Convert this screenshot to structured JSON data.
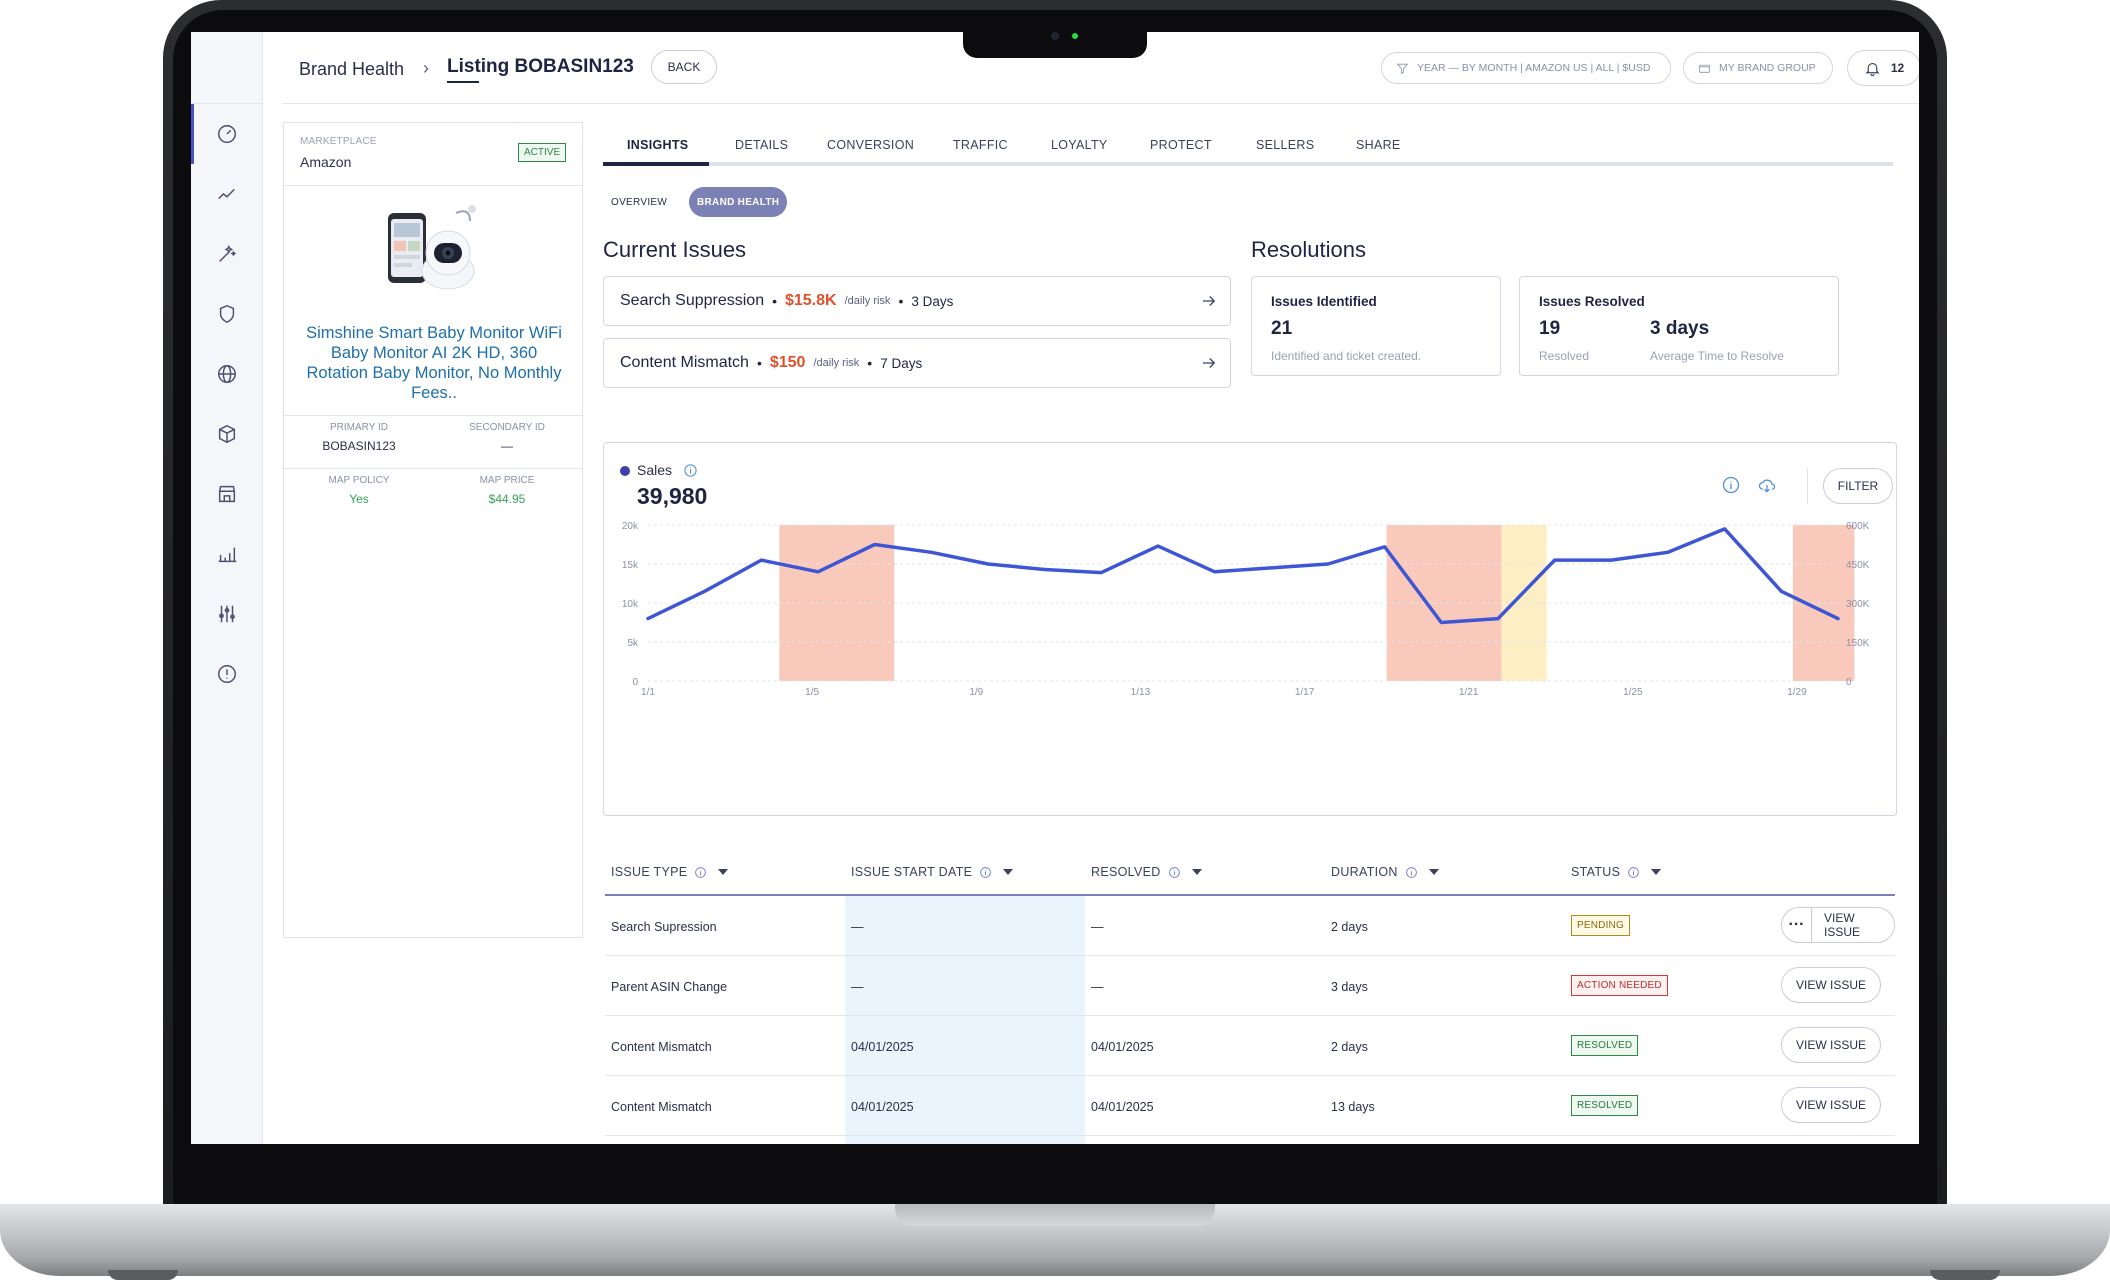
{
  "header": {
    "breadcrumb_parent": "Brand Health",
    "breadcrumb_separator": "›",
    "breadcrumb_current": "Listing BOBASIN123",
    "back_label": "BACK",
    "filter_pill": "YEAR — BY MONTH  |  AMAZON US  |  ALL  |  $USD",
    "brand_group_label": "MY BRAND GROUP",
    "notifications_count": "12"
  },
  "sidebar": {
    "items": [
      {
        "icon": "gauge-icon"
      },
      {
        "icon": "trend-line-icon"
      },
      {
        "icon": "magic-wand-icon"
      },
      {
        "icon": "shield-icon"
      },
      {
        "icon": "globe-icon"
      },
      {
        "icon": "package-icon"
      },
      {
        "icon": "storefront-icon"
      },
      {
        "icon": "bar-chart-icon"
      },
      {
        "icon": "sliders-icon"
      },
      {
        "icon": "info-icon"
      }
    ]
  },
  "product": {
    "marketplace_label": "MARKETPLACE",
    "marketplace": "Amazon",
    "status": "ACTIVE",
    "title": "Simshine Smart Baby Monitor WiFi Baby Monitor AI 2K HD, 360 Rotation Baby Monitor, No Monthly Fees..",
    "primary_id_label": "PRIMARY ID",
    "primary_id": "BOBASIN123",
    "secondary_id_label": "SECONDARY ID",
    "secondary_id": "—",
    "map_policy_label": "MAP POLICY",
    "map_policy": "Yes",
    "map_price_label": "MAP PRICE",
    "map_price": "$44.95"
  },
  "tabs": [
    "INSIGHTS",
    "DETAILS",
    "CONVERSION",
    "TRAFFIC",
    "LOYALTY",
    "PROTECT",
    "SELLERS",
    "SHARE"
  ],
  "subtabs": {
    "overview": "OVERVIEW",
    "brand_health": "BRAND HEALTH"
  },
  "current_issues": {
    "title": "Current Issues",
    "items": [
      {
        "name": "Search Suppression",
        "risk": "$15.8K",
        "risk_unit": "/daily risk",
        "days": "3 Days"
      },
      {
        "name": "Content Mismatch",
        "risk": "$150",
        "risk_unit": "/daily risk",
        "days": "7 Days"
      }
    ]
  },
  "resolutions": {
    "title": "Resolutions",
    "identified": {
      "title": "Issues Identified",
      "value": "21",
      "sub": "Identified and ticket created."
    },
    "resolved": {
      "title": "Issues Resolved",
      "value": "19",
      "sub": "Resolved",
      "avg_value": "3 days",
      "avg_sub": "Average Time to Resolve"
    }
  },
  "chart": {
    "label": "Sales",
    "total": "39,980",
    "filter_label": "FILTER"
  },
  "chart_data": {
    "type": "line",
    "series": [
      {
        "name": "Sales",
        "color": "#3f56d4",
        "values": [
          [
            0,
            8000
          ],
          [
            1,
            11500
          ],
          [
            2,
            15500
          ],
          [
            3,
            14000
          ],
          [
            4,
            17500
          ],
          [
            5,
            16500
          ],
          [
            6,
            15000
          ],
          [
            7,
            14300
          ],
          [
            8,
            13900
          ],
          [
            9,
            17300
          ],
          [
            10,
            14000
          ],
          [
            11,
            14500
          ],
          [
            12,
            15000
          ],
          [
            13,
            17200
          ],
          [
            14,
            7500
          ],
          [
            15,
            8000
          ],
          [
            16,
            15500
          ],
          [
            17,
            15500
          ],
          [
            18,
            16500
          ],
          [
            19,
            19500
          ],
          [
            20,
            11500
          ],
          [
            21,
            8000
          ]
        ]
      }
    ],
    "x_ticks": [
      "1/1",
      "1/5",
      "1/9",
      "1/13",
      "1/17",
      "1/21",
      "1/25",
      "1/29"
    ],
    "y_left_ticks": [
      "0",
      "5k",
      "10k",
      "15k",
      "20k"
    ],
    "y_right_ticks": [
      "0",
      "150K",
      "300K",
      "450K",
      "600K"
    ],
    "ylim": [
      0,
      20000
    ],
    "bands": [
      {
        "from": 3.2,
        "to": 6.0,
        "color": "#f9c9bc"
      },
      {
        "from": 18.0,
        "to": 20.8,
        "color": "#f9c9bc"
      },
      {
        "from": 20.8,
        "to": 21.9,
        "color": "#fdeec4"
      },
      {
        "from": 27.9,
        "to": 29.4,
        "color": "#f9c9bc"
      }
    ],
    "grid": true
  },
  "table": {
    "headers": [
      "ISSUE TYPE",
      "ISSUE START DATE",
      "RESOLVED",
      "DURATION",
      "STATUS"
    ],
    "rows": [
      {
        "type": "Search Supression",
        "start": "—",
        "resolved": "—",
        "duration": "2 days",
        "status": "PENDING",
        "status_kind": "pending",
        "action": "VIEW ISSUE",
        "more": "···"
      },
      {
        "type": "Parent ASIN Change",
        "start": "—",
        "resolved": "—",
        "duration": "3 days",
        "status": "ACTION NEEDED",
        "status_kind": "action",
        "action": "VIEW ISSUE"
      },
      {
        "type": "Content Mismatch",
        "start": "04/01/2025",
        "resolved": "04/01/2025",
        "duration": "2 days",
        "status": "RESOLVED",
        "status_kind": "resolved",
        "action": "VIEW ISSUE"
      },
      {
        "type": "Content Mismatch",
        "start": "04/01/2025",
        "resolved": "04/01/2025",
        "duration": "13 days",
        "status": "RESOLVED",
        "status_kind": "resolved",
        "action": "VIEW ISSUE"
      }
    ]
  }
}
